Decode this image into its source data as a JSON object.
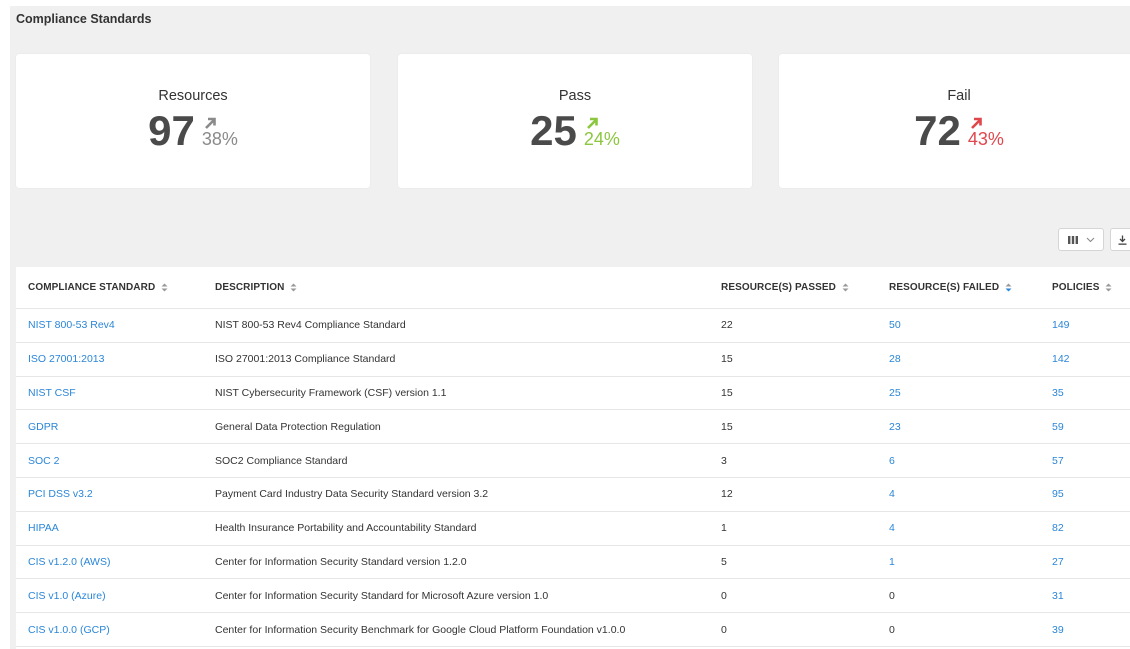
{
  "page": {
    "title": "Compliance Standards"
  },
  "cards": [
    {
      "label": "Resources",
      "value": "97",
      "delta": "38%",
      "color": "#8a8a8a",
      "trend": "up"
    },
    {
      "label": "Pass",
      "value": "25",
      "delta": "24%",
      "color": "#8cc63f",
      "trend": "up"
    },
    {
      "label": "Fail",
      "value": "72",
      "delta": "43%",
      "color": "#e0474c",
      "trend": "up"
    }
  ],
  "toolbar": {
    "columns_icon": "columns-icon",
    "dropdown_icon": "chevron-down-icon",
    "download_icon": "download-icon"
  },
  "table": {
    "headers": {
      "standard": "COMPLIANCE STANDARD",
      "description": "DESCRIPTION",
      "passed": "RESOURCE(S) PASSED",
      "failed": "RESOURCE(S) FAILED",
      "policies": "POLICIES"
    },
    "sorted_column": "failed",
    "rows": [
      {
        "standard": "NIST 800-53 Rev4",
        "description": "NIST 800-53 Rev4 Compliance Standard",
        "passed": "22",
        "failed": "50",
        "failed_link": true,
        "policies": "149"
      },
      {
        "standard": "ISO 27001:2013",
        "description": "ISO 27001:2013 Compliance Standard",
        "passed": "15",
        "failed": "28",
        "failed_link": true,
        "policies": "142"
      },
      {
        "standard": "NIST CSF",
        "description": "NIST Cybersecurity Framework (CSF) version 1.1",
        "passed": "15",
        "failed": "25",
        "failed_link": true,
        "policies": "35"
      },
      {
        "standard": "GDPR",
        "description": "General Data Protection Regulation",
        "passed": "15",
        "failed": "23",
        "failed_link": true,
        "policies": "59"
      },
      {
        "standard": "SOC 2",
        "description": "SOC2 Compliance Standard",
        "passed": "3",
        "failed": "6",
        "failed_link": true,
        "policies": "57"
      },
      {
        "standard": "PCI DSS v3.2",
        "description": "Payment Card Industry Data Security Standard version 3.2",
        "passed": "12",
        "failed": "4",
        "failed_link": true,
        "policies": "95"
      },
      {
        "standard": "HIPAA",
        "description": "Health Insurance Portability and Accountability Standard",
        "passed": "1",
        "failed": "4",
        "failed_link": true,
        "policies": "82"
      },
      {
        "standard": "CIS v1.2.0 (AWS)",
        "description": "Center for Information Security Standard version 1.2.0",
        "passed": "5",
        "failed": "1",
        "failed_link": true,
        "policies": "27"
      },
      {
        "standard": "CIS v1.0 (Azure)",
        "description": "Center for Information Security Standard for Microsoft Azure version 1.0",
        "passed": "0",
        "failed": "0",
        "failed_link": false,
        "policies": "31"
      },
      {
        "standard": "CIS v1.0.0 (GCP)",
        "description": "Center for Information Security Benchmark for Google Cloud Platform Foundation v1.0.0",
        "passed": "0",
        "failed": "0",
        "failed_link": false,
        "policies": "39"
      }
    ]
  }
}
